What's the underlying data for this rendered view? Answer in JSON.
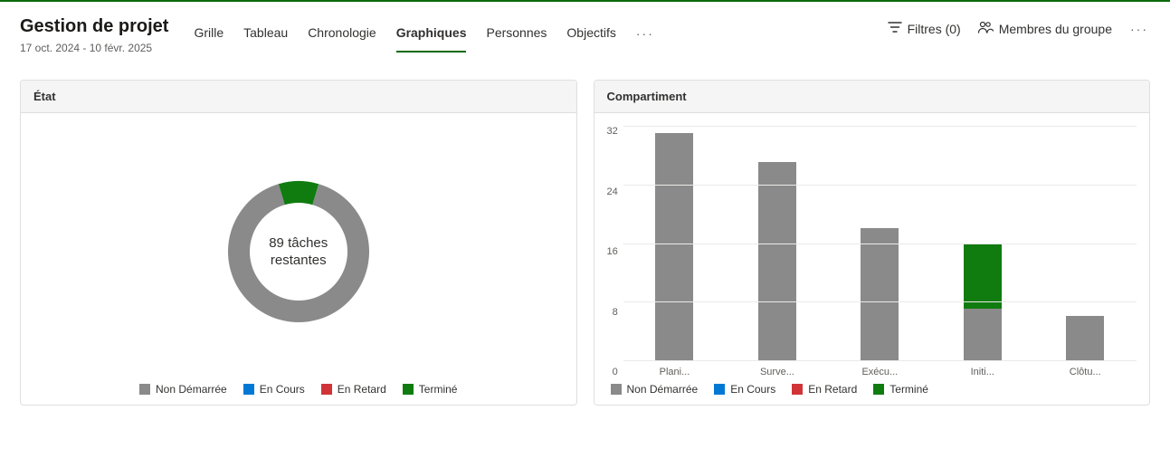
{
  "header": {
    "title": "Gestion de projet",
    "date_range": "17 oct. 2024 - 10 févr. 2025"
  },
  "tabs": {
    "items": [
      {
        "label": "Grille",
        "active": false
      },
      {
        "label": "Tableau",
        "active": false
      },
      {
        "label": "Chronologie",
        "active": false
      },
      {
        "label": "Graphiques",
        "active": true
      },
      {
        "label": "Personnes",
        "active": false
      },
      {
        "label": "Objectifs",
        "active": false
      }
    ]
  },
  "actions": {
    "filters_label": "Filtres (0)",
    "members_label": "Membres du groupe"
  },
  "colors": {
    "not_started": "#8a8a8a",
    "in_progress": "#0078d4",
    "late": "#d13438",
    "completed": "#107c10",
    "gridline": "#eceae8"
  },
  "legend_labels": {
    "not_started": "Non Démarrée",
    "in_progress": "En Cours",
    "late": "En Retard",
    "completed": "Terminé"
  },
  "card_status": {
    "title": "État",
    "center_line1": "89 tâches",
    "center_line2": "restantes"
  },
  "card_bucket": {
    "title": "Compartiment"
  },
  "chart_data": [
    {
      "type": "pie",
      "title": "État",
      "subtype": "donut",
      "center_text": "89 tâches restantes",
      "series": [
        {
          "name": "Terminé",
          "value": 9,
          "color": "#107c10"
        },
        {
          "name": "Non Démarrée",
          "value": 89,
          "color": "#8a8a8a"
        },
        {
          "name": "En Cours",
          "value": 0,
          "color": "#0078d4"
        },
        {
          "name": "En Retard",
          "value": 0,
          "color": "#d13438"
        }
      ],
      "legend": [
        "Non Démarrée",
        "En Cours",
        "En Retard",
        "Terminé"
      ]
    },
    {
      "type": "bar",
      "title": "Compartiment",
      "stacked": true,
      "ylim": [
        0,
        32
      ],
      "yticks": [
        0,
        8,
        16,
        24,
        32
      ],
      "xlabel": "",
      "ylabel": "",
      "categories": [
        "Plani...",
        "Surve...",
        "Exécu...",
        "Initi...",
        "Clôtu..."
      ],
      "series": [
        {
          "name": "Non Démarrée",
          "color": "#8a8a8a",
          "values": [
            31,
            27,
            18,
            7,
            6
          ]
        },
        {
          "name": "En Cours",
          "color": "#0078d4",
          "values": [
            0,
            0,
            0,
            0,
            0
          ]
        },
        {
          "name": "En Retard",
          "color": "#d13438",
          "values": [
            0,
            0,
            0,
            0,
            0
          ]
        },
        {
          "name": "Terminé",
          "color": "#107c10",
          "values": [
            0,
            0,
            0,
            9,
            0
          ]
        }
      ],
      "legend": [
        "Non Démarrée",
        "En Cours",
        "En Retard",
        "Terminé"
      ]
    }
  ]
}
